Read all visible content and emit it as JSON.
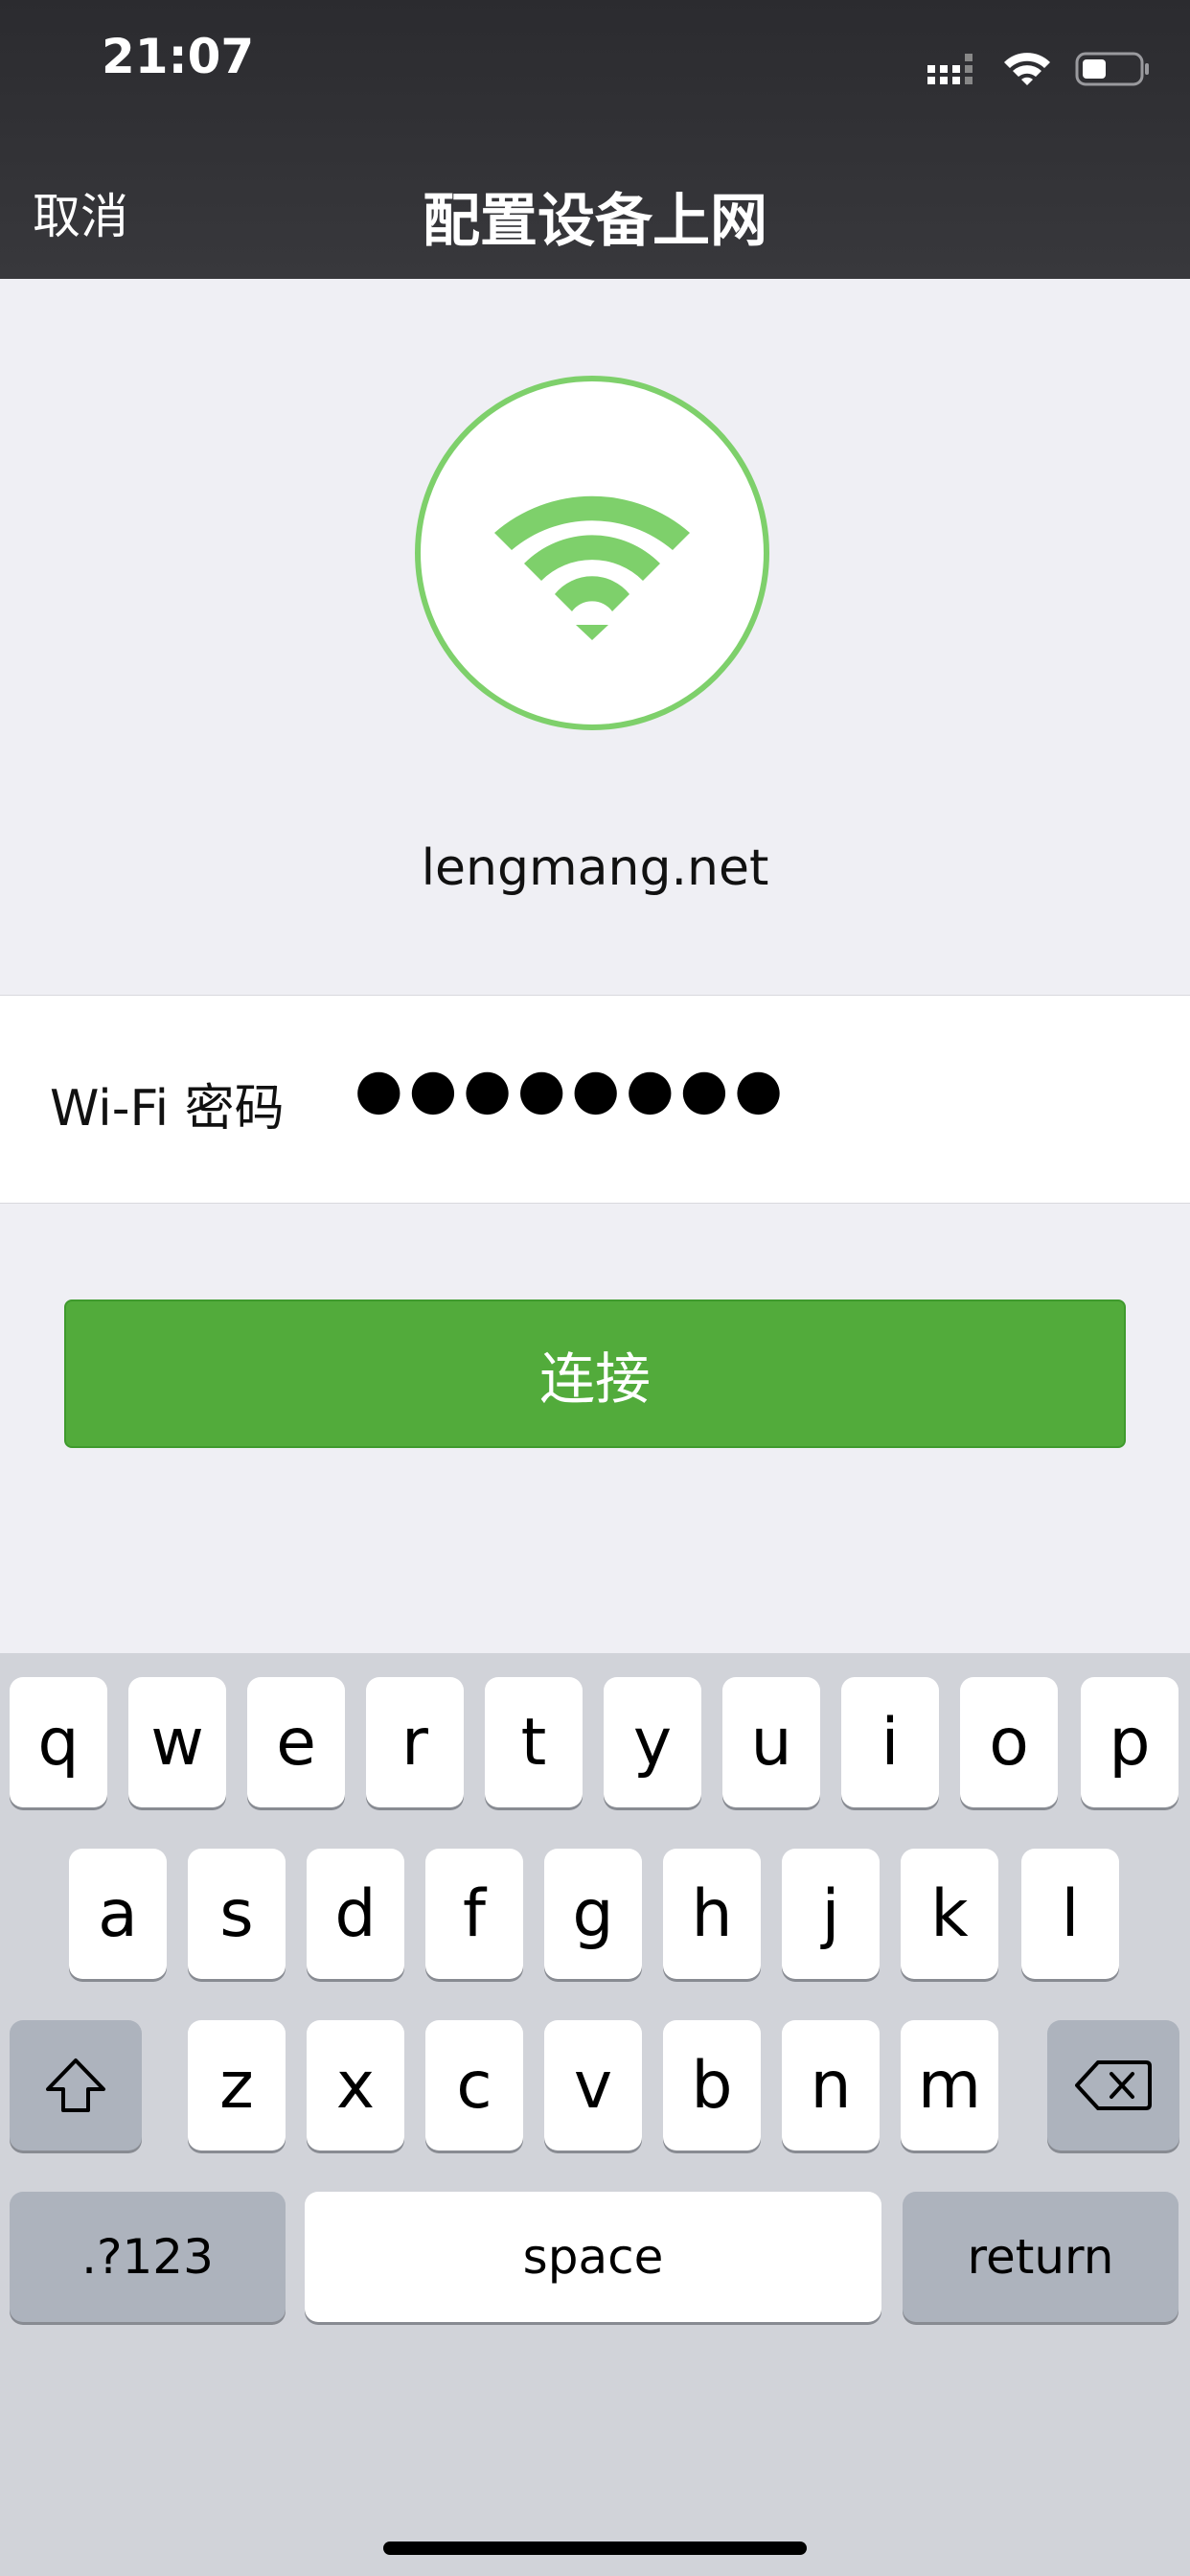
{
  "status_bar": {
    "time": "21:07"
  },
  "nav": {
    "cancel": "取消",
    "title": "配置设备上网"
  },
  "network": {
    "ssid": "lengmang.net"
  },
  "password_field": {
    "label": "Wi-Fi 密码",
    "value": "●●●●●●●●"
  },
  "actions": {
    "connect": "连接"
  },
  "keyboard": {
    "row1": [
      "q",
      "w",
      "e",
      "r",
      "t",
      "y",
      "u",
      "i",
      "o",
      "p"
    ],
    "row2": [
      "a",
      "s",
      "d",
      "f",
      "g",
      "h",
      "j",
      "k",
      "l"
    ],
    "row3": [
      "z",
      "x",
      "c",
      "v",
      "b",
      "n",
      "m"
    ],
    "numbers": ".?123",
    "space": "space",
    "return": "return"
  },
  "colors": {
    "accent": "#52ab3b",
    "wifi_green": "#7ed06b",
    "header": "#2f2f33"
  }
}
